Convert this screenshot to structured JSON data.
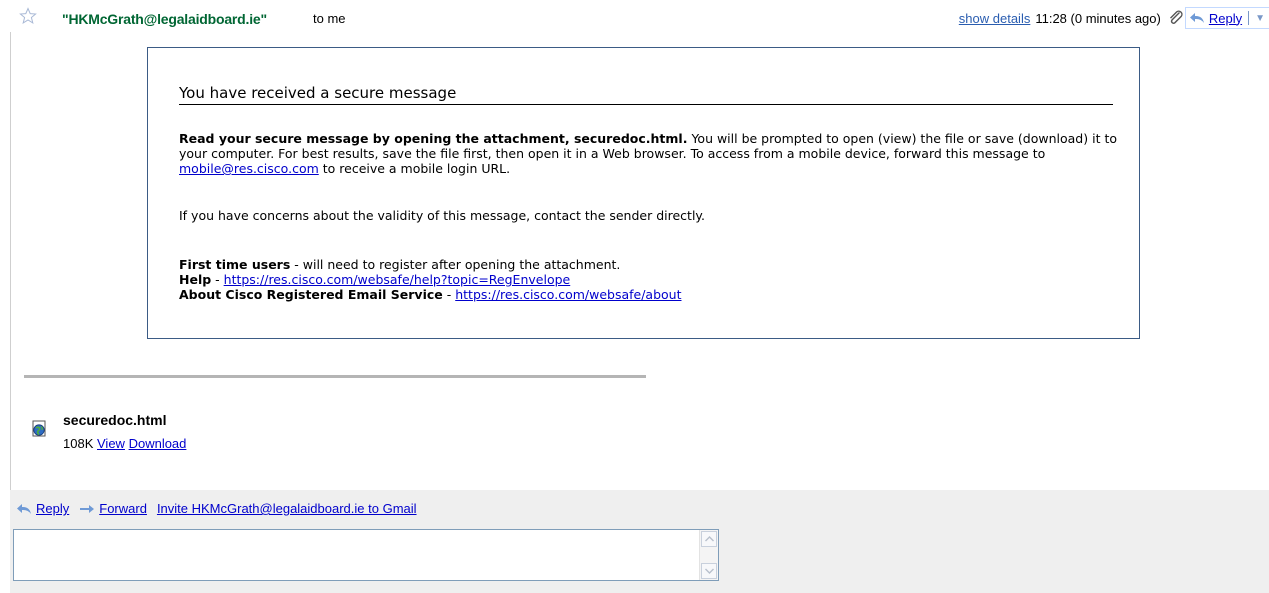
{
  "header": {
    "sender": "\"HKMcGrath@legalaidboard.ie\"",
    "to": "to me",
    "show_details": "show details",
    "time": "11:28 (0 minutes ago)",
    "reply": "Reply"
  },
  "message": {
    "title": "You have received a secure message",
    "p1_bold": "Read your secure message by opening the attachment, securedoc.html.",
    "p1_text": " You will be prompted to open (view) the file or save (download) it to your computer. For best results, save the file first, then open it in a Web browser. To access from a mobile device, forward this message to ",
    "p1_link": "mobile@res.cisco.com",
    "p1_end": " to receive a mobile login URL.",
    "p2": "If you have concerns about the validity of this message, contact the sender directly.",
    "first_time_bold": "First time users",
    "first_time_text": " - will need to register after opening the attachment.",
    "help_bold": "Help",
    "help_sep": " - ",
    "help_link": "https://res.cisco.com/websafe/help?topic=RegEnvelope",
    "about_bold": "About Cisco Registered Email Service",
    "about_sep": " - ",
    "about_link": "https://res.cisco.com/websafe/about"
  },
  "attachment": {
    "name": "securedoc.html",
    "size": "108K",
    "view": "View",
    "download": "Download"
  },
  "footer": {
    "reply": "Reply",
    "forward": "Forward",
    "invite": "Invite HKMcGrath@legalaidboard.ie to Gmail",
    "reply_text": ""
  },
  "colors": {
    "sender": "#006633",
    "link": "#0000cc",
    "card_border": "#3b5b85",
    "footer_bg": "#efefef"
  }
}
